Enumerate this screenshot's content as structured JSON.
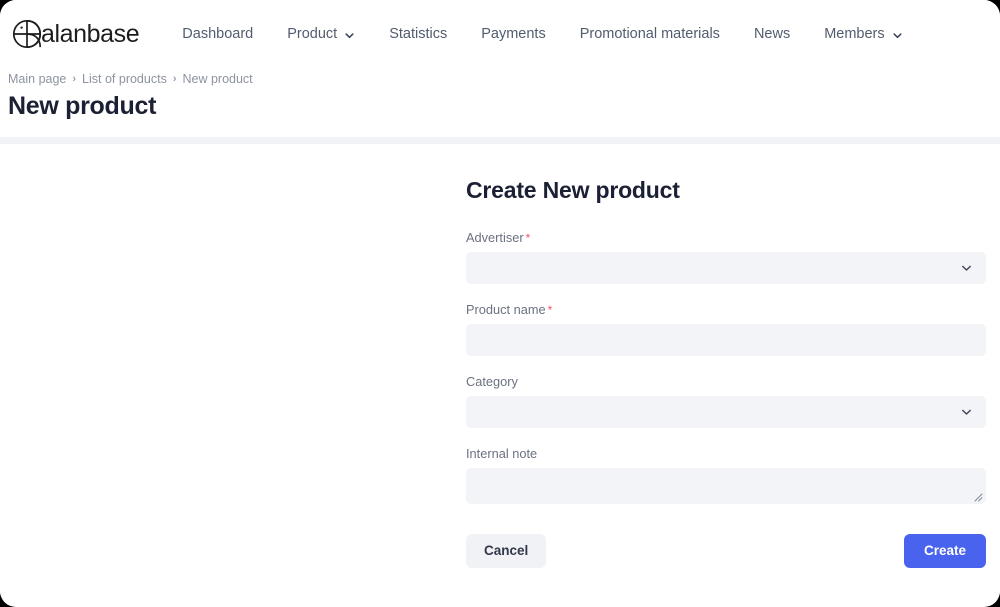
{
  "brand": {
    "name": "alanbase",
    "logo_icon": "circle-cross-b-logo-icon"
  },
  "nav": {
    "items": [
      {
        "label": "Dashboard",
        "has_caret": false
      },
      {
        "label": "Product",
        "has_caret": true
      },
      {
        "label": "Statistics",
        "has_caret": false
      },
      {
        "label": "Payments",
        "has_caret": false
      },
      {
        "label": "Promotional materials",
        "has_caret": false
      },
      {
        "label": "News",
        "has_caret": false
      },
      {
        "label": "Members",
        "has_caret": true
      }
    ]
  },
  "breadcrumb": {
    "separator": "›",
    "items": [
      {
        "label": "Main page"
      },
      {
        "label": "List of products"
      },
      {
        "label": "New product"
      }
    ]
  },
  "page": {
    "title": "New product"
  },
  "form": {
    "heading": "Create New product",
    "required_marker": "*",
    "fields": [
      {
        "label": "Advertiser",
        "required": true,
        "type": "select",
        "value": "",
        "placeholder": "",
        "icon": "chevron-down-icon"
      },
      {
        "label": "Product name",
        "required": true,
        "type": "text",
        "value": "",
        "placeholder": ""
      },
      {
        "label": "Category",
        "required": false,
        "type": "select",
        "value": "",
        "placeholder": "",
        "icon": "chevron-down-icon"
      },
      {
        "label": "Internal note",
        "required": false,
        "type": "textarea",
        "value": "",
        "placeholder": ""
      }
    ],
    "cancel_label": "Cancel",
    "create_label": "Create"
  },
  "colors": {
    "accent": "#4a63ee",
    "required": "#f4566a",
    "field_bg": "#f3f4f8",
    "cancel_bg": "#f1f2f6",
    "title": "#1b2034",
    "muted": "#6b7280"
  }
}
